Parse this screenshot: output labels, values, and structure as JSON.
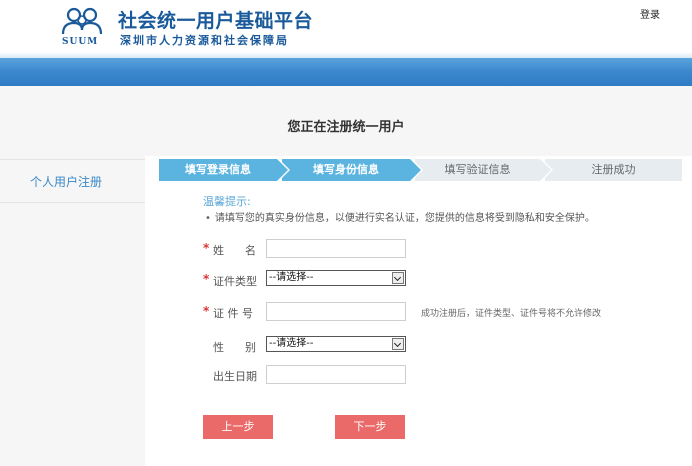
{
  "header": {
    "logo_text": "SUUM",
    "brand_title": "社会统一用户基础平台",
    "brand_subtitle": "深圳市人力资源和社会保障局",
    "login_link": "登录"
  },
  "page": {
    "title": "您正在注册统一用户"
  },
  "sidebar": {
    "items": [
      {
        "label": "个人用户注册"
      }
    ]
  },
  "steps": [
    {
      "label": "填写登录信息",
      "state": "active"
    },
    {
      "label": "填写身份信息",
      "state": "active"
    },
    {
      "label": "填写验证信息",
      "state": "inactive"
    },
    {
      "label": "注册成功",
      "state": "inactive"
    }
  ],
  "tip": {
    "title": "温馨提示:",
    "text": "请填写您的真实身份信息，以便进行实名认证，您提供的信息将受到隐私和安全保护。"
  },
  "form": {
    "name": {
      "label": "姓      名",
      "required": true,
      "value": ""
    },
    "id_type": {
      "label": "证件类型",
      "required": true,
      "selected": "--请选择--"
    },
    "id_number": {
      "label": "证 件 号",
      "required": true,
      "value": "",
      "note": "成功注册后，证件类型、证件号将不允许修改"
    },
    "gender": {
      "label": "性      别",
      "required": false,
      "selected": "--请选择--"
    },
    "birth_date": {
      "label": "出生日期",
      "required": false,
      "value": ""
    }
  },
  "buttons": {
    "prev": "上一步",
    "next": "下一步"
  },
  "colors": {
    "brand_blue": "#1a5a9a",
    "step_active": "#5bb4e0",
    "step_inactive": "#e6ecf0",
    "button": "#ea6a6a",
    "required_star": "#d33333"
  }
}
